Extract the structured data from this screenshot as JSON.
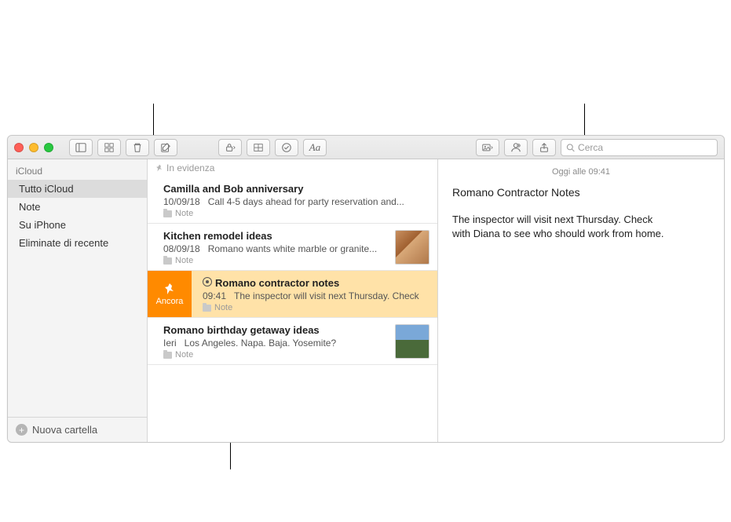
{
  "traffic": {
    "close": "#ff5f57",
    "min": "#febc2e",
    "max": "#28c840"
  },
  "search": {
    "placeholder": "Cerca"
  },
  "sidebar": {
    "section": "iCloud",
    "items": [
      {
        "label": "Tutto iCloud",
        "selected": true
      },
      {
        "label": "Note",
        "selected": false
      },
      {
        "label": "Su iPhone",
        "selected": false
      },
      {
        "label": "Eliminate di recente",
        "selected": false
      }
    ],
    "new_folder": "Nuova cartella"
  },
  "list": {
    "header": "In evidenza",
    "pinned_label": "Ancora",
    "notes": [
      {
        "title": "Camilla and Bob anniversary",
        "date": "10/09/18",
        "preview": "Call 4-5 days ahead for party reservation and...",
        "folder": "Note",
        "thumb": null,
        "selected": false,
        "shared": false
      },
      {
        "title": "Kitchen remodel ideas",
        "date": "08/09/18",
        "preview": "Romano wants white marble or granite...",
        "folder": "Note",
        "thumb": "wood",
        "selected": false,
        "shared": false
      },
      {
        "title": "Romano contractor notes",
        "date": "09:41",
        "preview": "The inspector will visit next Thursday. Check",
        "folder": "Note",
        "thumb": null,
        "selected": true,
        "shared": true
      },
      {
        "title": "Romano birthday getaway ideas",
        "date": "Ieri",
        "preview": "Los Angeles. Napa. Baja. Yosemite?",
        "folder": "Note",
        "thumb": "photo",
        "selected": false,
        "shared": false
      }
    ]
  },
  "editor": {
    "date": "Oggi alle 09:41",
    "title": "Romano Contractor Notes",
    "body": "The inspector will visit next Thursday. Check with Diana to see who should work from home."
  }
}
